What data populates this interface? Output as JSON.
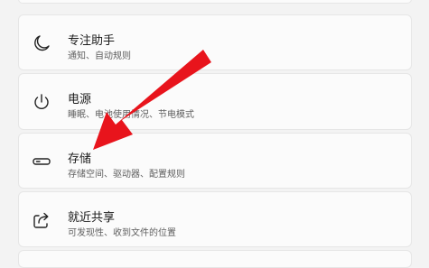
{
  "settings": {
    "items": [
      {
        "title": "专注助手",
        "subtitle": "通知、自动规则",
        "icon": "moon-icon"
      },
      {
        "title": "电源",
        "subtitle": "睡眠、电池使用情况、节电模式",
        "icon": "power-icon"
      },
      {
        "title": "存储",
        "subtitle": "存储空间、驱动器、配置规则",
        "icon": "storage-drive-icon"
      },
      {
        "title": "就近共享",
        "subtitle": "可发现性、收到文件的位置",
        "icon": "share-icon"
      }
    ]
  },
  "annotation": {
    "arrow_color": "#e8141c",
    "points_to": "存储"
  }
}
